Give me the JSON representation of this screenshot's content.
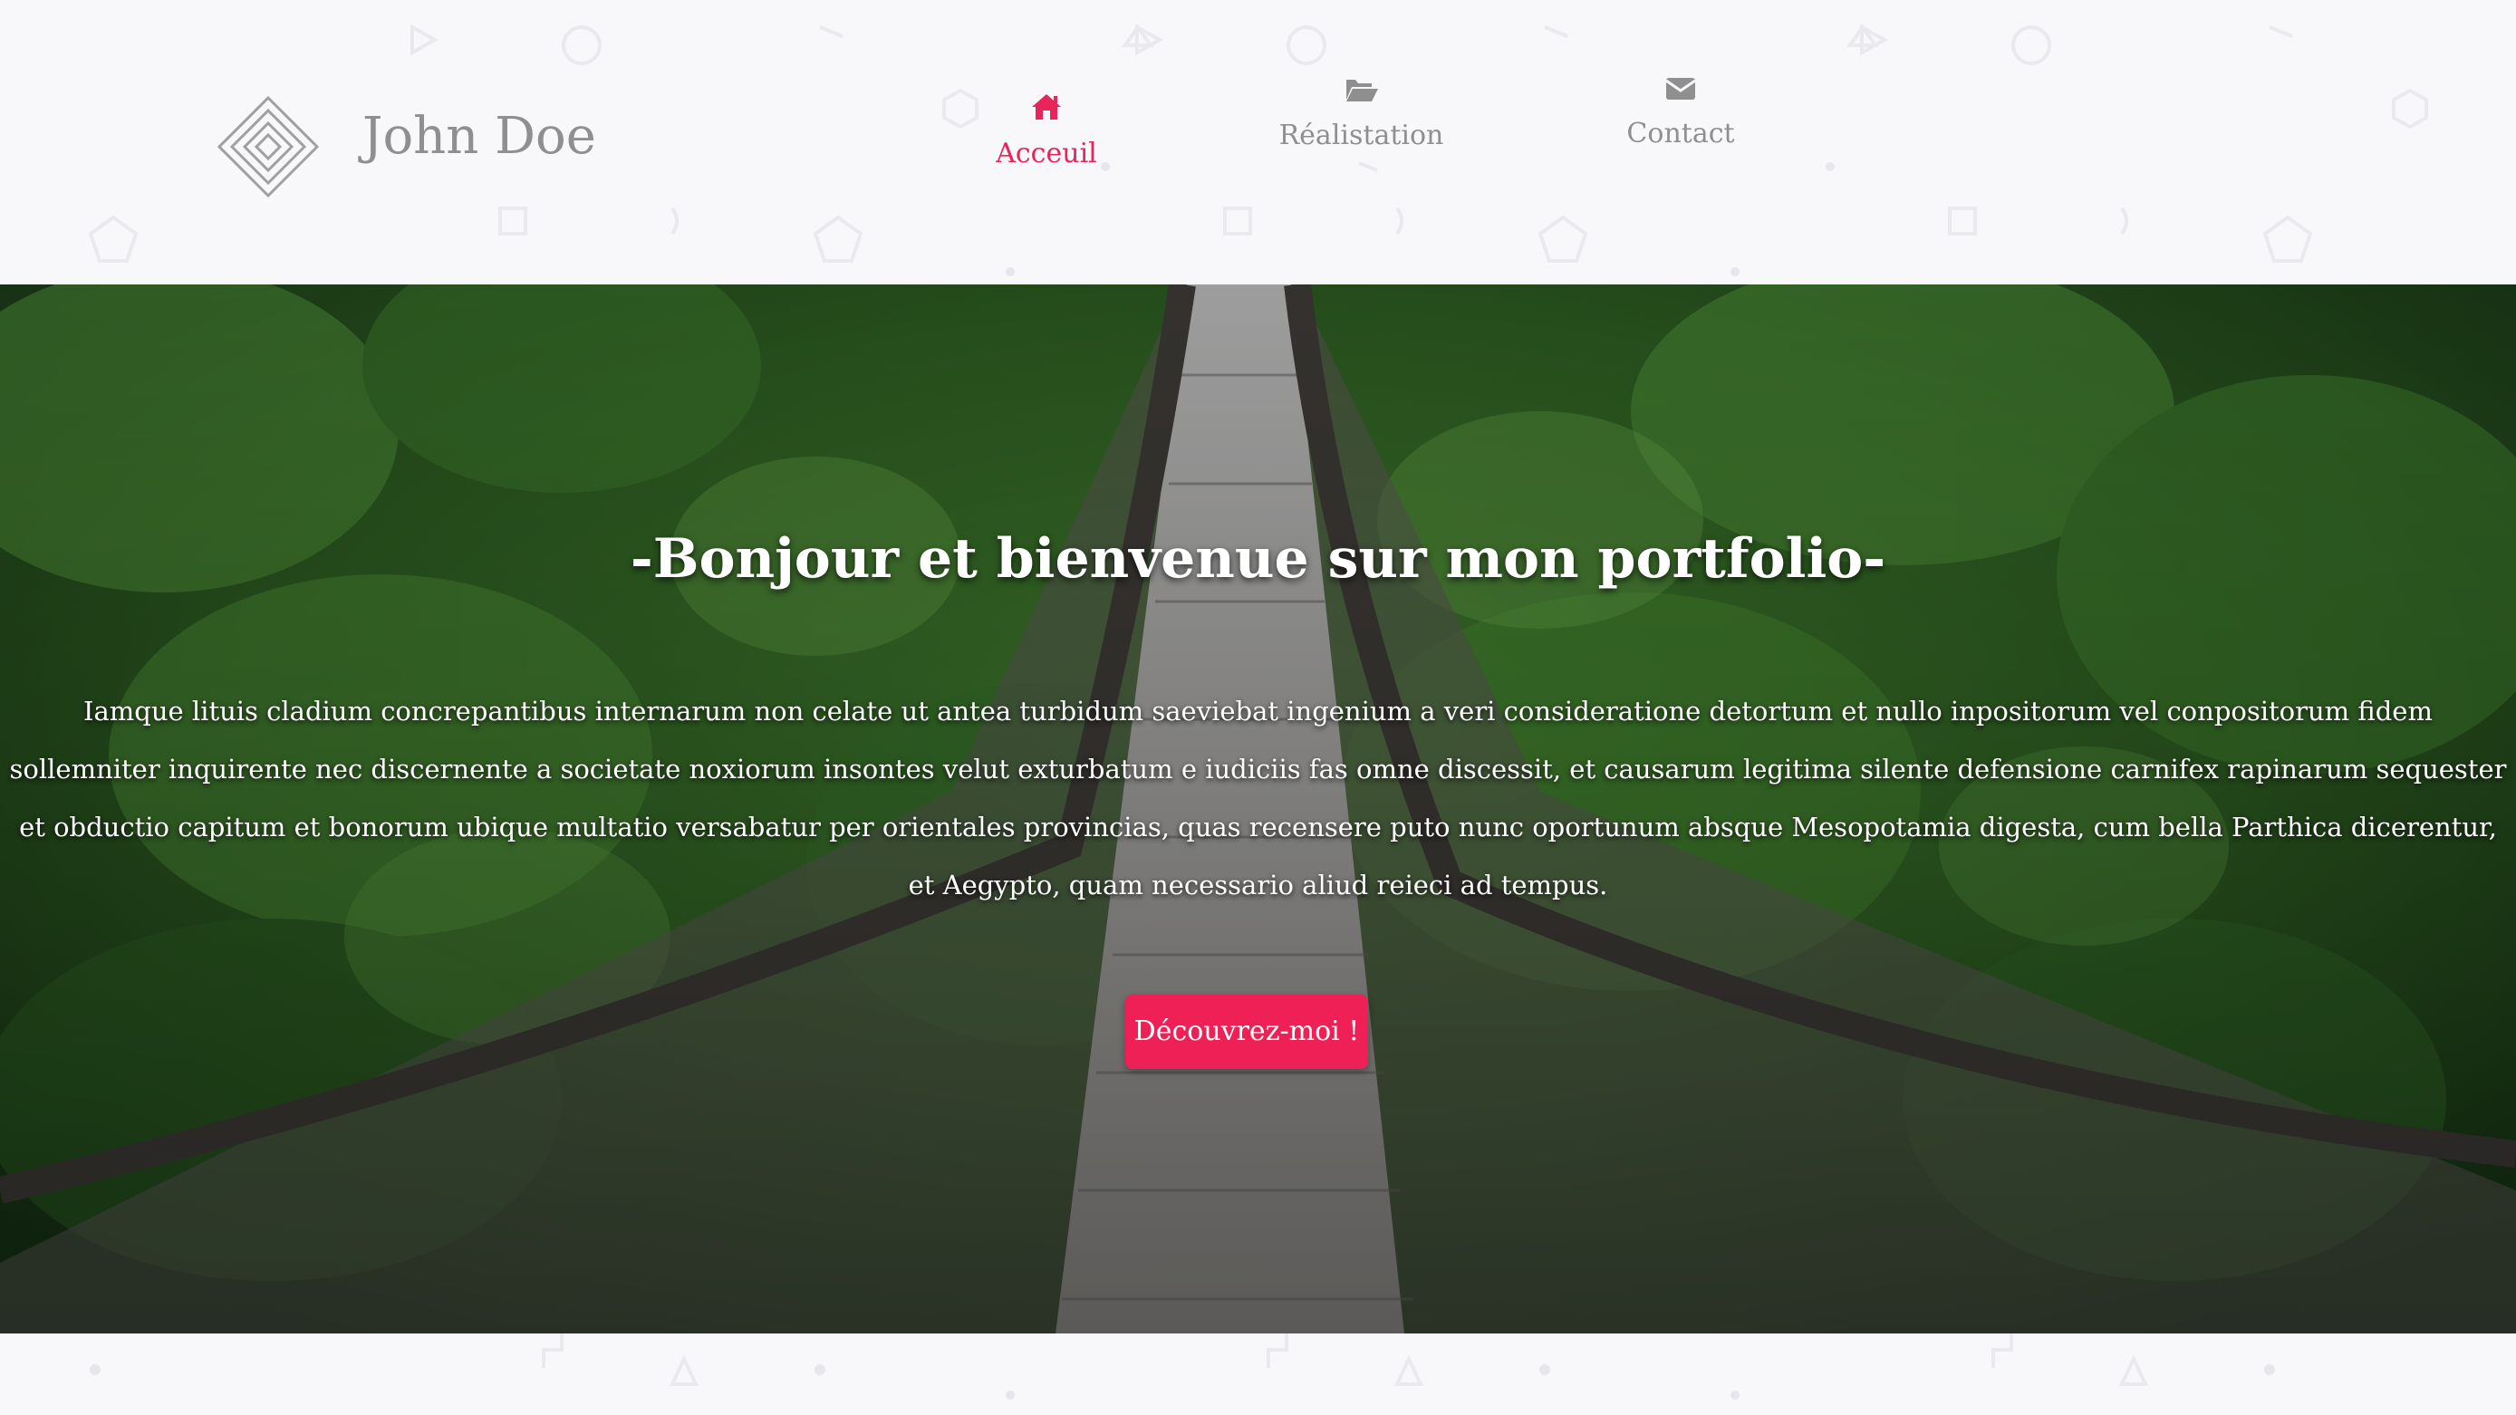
{
  "brand": {
    "name": "John Doe",
    "logo_icon": "diamond-logo-icon"
  },
  "nav": {
    "items": [
      {
        "label": "Acceuil",
        "icon": "home-icon",
        "active": true
      },
      {
        "label": "Réalistation",
        "icon": "folder-open-icon",
        "active": false
      },
      {
        "label": "Contact",
        "icon": "envelope-icon",
        "active": false
      }
    ]
  },
  "hero": {
    "title": "-Bonjour et bienvenue sur mon portfolio-",
    "text": "Iamque lituis cladium concrepantibus internarum non celate ut antea turbidum saeviebat ingenium a veri consideratione detortum et nullo inpositorum vel conpositorum fidem sollemniter inquirente nec discernente a societate noxiorum insontes velut exturbatum e iudiciis fas omne discessit, et causarum legitima silente defensione carnifex rapinarum sequester et obductio capitum et bonorum ubique multatio versabatur per orientales provincias, quas recensere puto nunc oportunum absque Mesopotamia digesta, cum bella Parthica dicerentur, et Aegypto, quam necessario aliud reieci ad tempus.",
    "cta_label": "Découvrez-moi !",
    "background": "forest-suspension-bridge-photo"
  },
  "colors": {
    "accent": "#ee2055",
    "nav_inactive": "#8f8f8f",
    "background": "#f8f8fa"
  }
}
